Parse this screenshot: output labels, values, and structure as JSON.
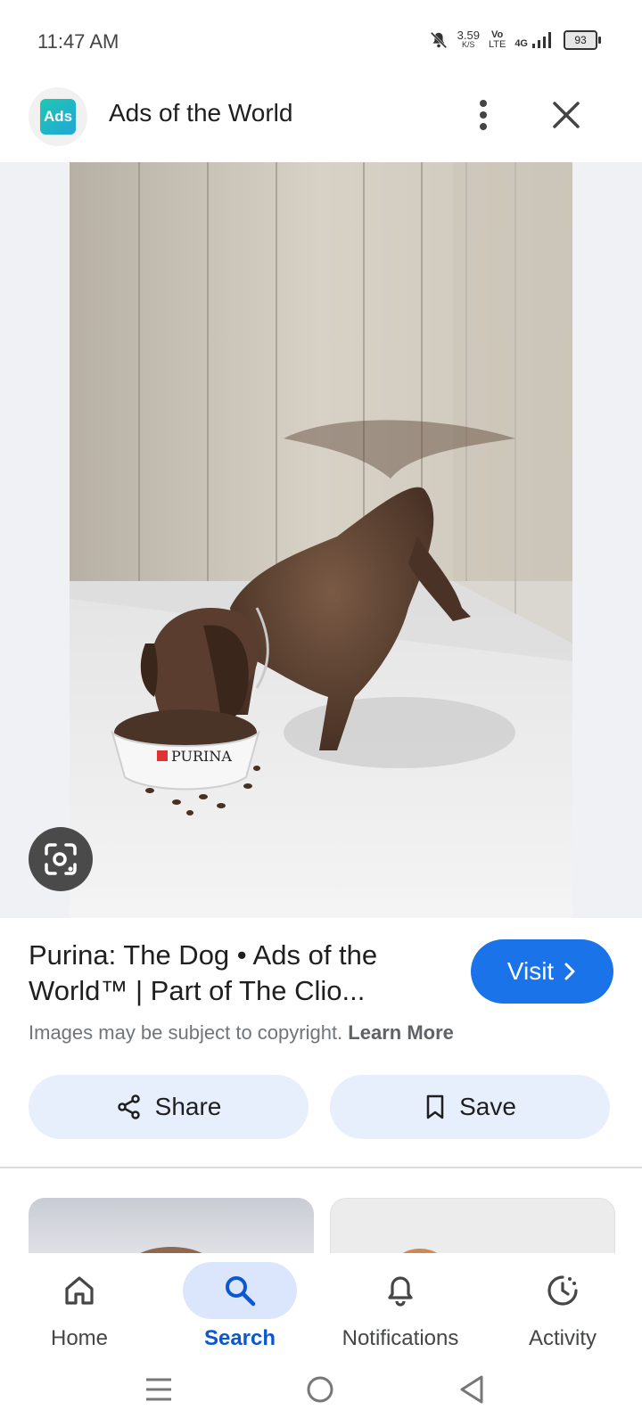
{
  "status_bar": {
    "time": "11:47 AM",
    "net_speed": "3.59",
    "net_unit": "K/S",
    "volte_top": "Vo",
    "volte_bottom": "LTE",
    "network": "4G",
    "battery": "93"
  },
  "header": {
    "logo_text": "Ads",
    "site_name": "Ads of the World"
  },
  "image": {
    "brand_on_bowl": "PURINA"
  },
  "result": {
    "title": "Purina: The Dog • Ads of the World™ | Part of The Clio...",
    "visit_label": "Visit",
    "copyright_text": "Images may be subject to copyright.",
    "learn_more": "Learn More"
  },
  "actions": {
    "share_label": "Share",
    "save_label": "Save"
  },
  "bottom_nav": {
    "items": [
      {
        "label": "Home",
        "icon": "home-icon"
      },
      {
        "label": "Search",
        "icon": "search-icon",
        "selected": true
      },
      {
        "label": "Notifications",
        "icon": "bell-icon"
      },
      {
        "label": "Activity",
        "icon": "activity-icon"
      }
    ]
  },
  "colors": {
    "accent": "#1a73e8",
    "selected_nav": "#0b57d0",
    "pill_bg": "#e8effc"
  }
}
